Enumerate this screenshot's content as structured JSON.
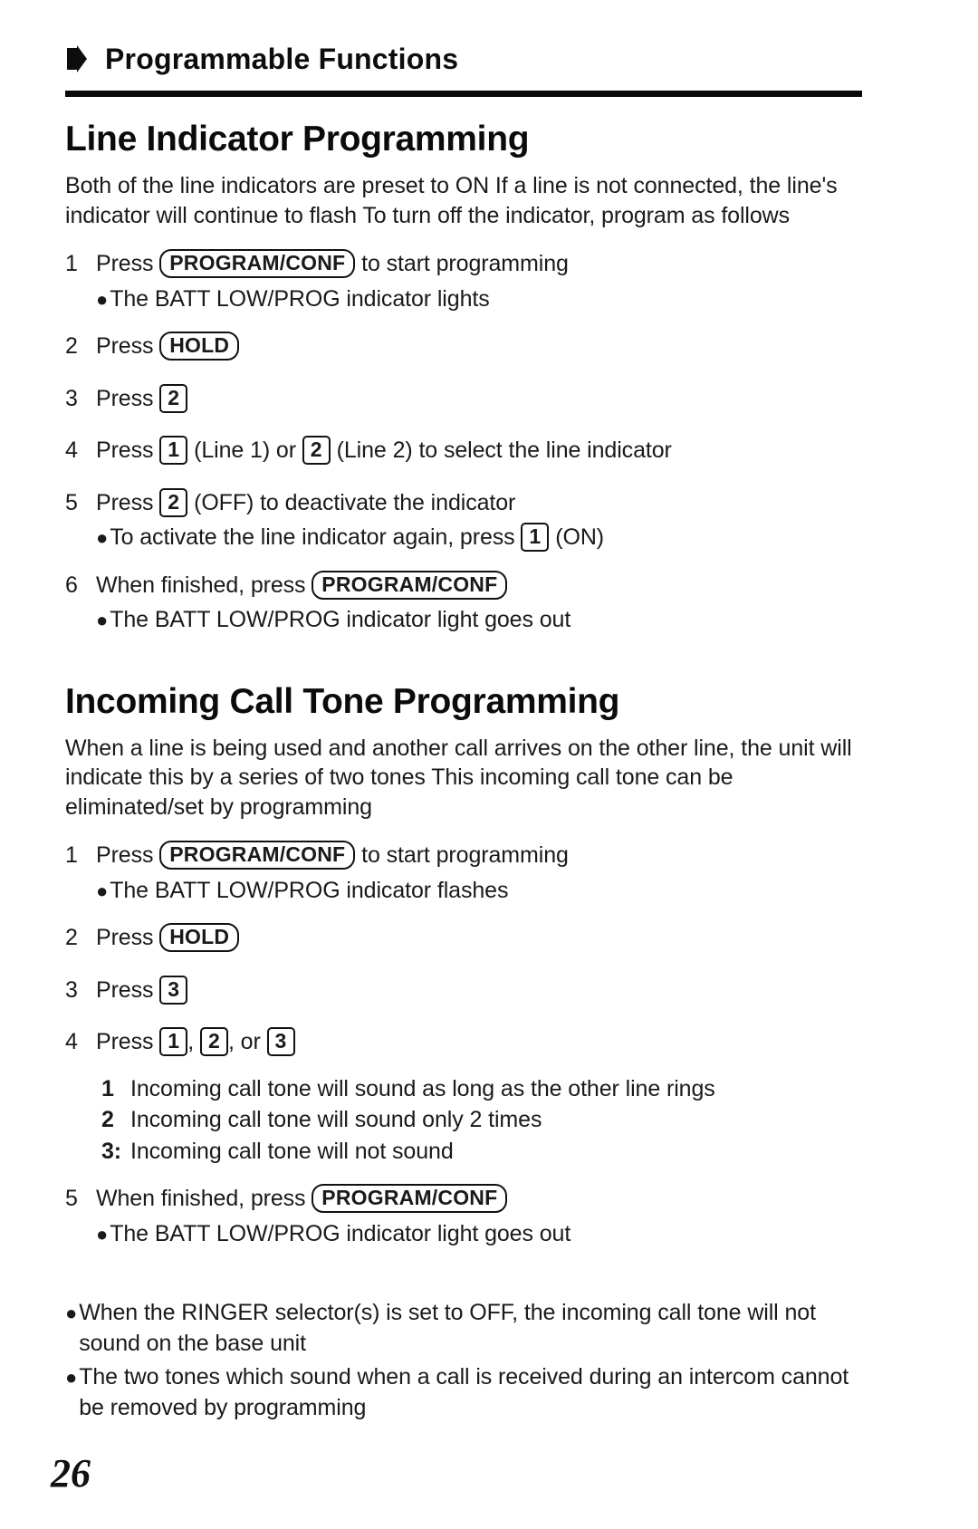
{
  "running_header": {
    "arrow_icon": "right-arrow-icon",
    "title": "Programmable Functions"
  },
  "sections": [
    {
      "title": "Line Indicator Programming",
      "intro": "Both of the line indicators are preset to ON  If a line is not connected, the line's indicator will continue to flash  To turn off the indicator, program as follows",
      "steps": [
        {
          "num": "1",
          "parts": [
            {
              "t": "text",
              "v": "Press "
            },
            {
              "t": "key",
              "v": "PROGRAM/CONF"
            },
            {
              "t": "text",
              "v": " to start programming"
            }
          ],
          "bullets": [
            "The BATT LOW/PROG indicator lights"
          ]
        },
        {
          "num": "2",
          "parts": [
            {
              "t": "text",
              "v": "Press "
            },
            {
              "t": "key",
              "v": "HOLD"
            }
          ],
          "bullets": []
        },
        {
          "num": "3",
          "parts": [
            {
              "t": "text",
              "v": "Press "
            },
            {
              "t": "numkey",
              "v": "2"
            }
          ],
          "bullets": []
        },
        {
          "num": "4",
          "parts": [
            {
              "t": "text",
              "v": "Press "
            },
            {
              "t": "numkey",
              "v": "1"
            },
            {
              "t": "text",
              "v": " (Line 1) or "
            },
            {
              "t": "numkey",
              "v": "2"
            },
            {
              "t": "text",
              "v": " (Line 2) to select the line indicator"
            }
          ],
          "bullets": []
        },
        {
          "num": "5",
          "parts": [
            {
              "t": "text",
              "v": "Press "
            },
            {
              "t": "numkey",
              "v": "2"
            },
            {
              "t": "text",
              "v": " (OFF) to deactivate the indicator"
            }
          ],
          "bullets_rich": [
            [
              {
                "t": "text",
                "v": "To activate the line indicator again, press "
              },
              {
                "t": "numkey",
                "v": "1"
              },
              {
                "t": "text",
                "v": " (ON)"
              }
            ]
          ]
        },
        {
          "num": "6",
          "parts": [
            {
              "t": "text",
              "v": "When finished, press "
            },
            {
              "t": "key",
              "v": "PROGRAM/CONF"
            }
          ],
          "bullets": [
            "The BATT LOW/PROG indicator light goes out"
          ]
        }
      ]
    },
    {
      "title": "Incoming Call Tone Programming",
      "intro": "When a line is being used and another call arrives on the other line, the unit will indicate this by a series of two tones  This incoming call tone can be eliminated/set by programming",
      "steps": [
        {
          "num": "1",
          "parts": [
            {
              "t": "text",
              "v": "Press "
            },
            {
              "t": "key",
              "v": "PROGRAM/CONF"
            },
            {
              "t": "text",
              "v": " to start programming"
            }
          ],
          "bullets": [
            "The BATT LOW/PROG indicator flashes"
          ]
        },
        {
          "num": "2",
          "parts": [
            {
              "t": "text",
              "v": "Press "
            },
            {
              "t": "key",
              "v": "HOLD"
            }
          ],
          "bullets": []
        },
        {
          "num": "3",
          "parts": [
            {
              "t": "text",
              "v": "Press "
            },
            {
              "t": "numkey",
              "v": "3"
            }
          ],
          "bullets": []
        },
        {
          "num": "4",
          "parts": [
            {
              "t": "text",
              "v": "Press "
            },
            {
              "t": "numkey",
              "v": "1"
            },
            {
              "t": "text",
              "v": ", "
            },
            {
              "t": "numkey",
              "v": "2"
            },
            {
              "t": "text",
              "v": ", or "
            },
            {
              "t": "numkey",
              "v": "3"
            }
          ],
          "bullets": [],
          "inner_list": [
            {
              "num": "1",
              "text": "Incoming call tone will sound as long as the other line rings"
            },
            {
              "num": "2",
              "text": "Incoming call tone will sound only 2 times"
            },
            {
              "num": "3:",
              "text": "Incoming call tone will not sound"
            }
          ]
        },
        {
          "num": "5",
          "parts": [
            {
              "t": "text",
              "v": "When finished, press "
            },
            {
              "t": "key",
              "v": "PROGRAM/CONF"
            }
          ],
          "bullets": [
            "The BATT LOW/PROG indicator light goes out"
          ]
        }
      ],
      "notes": [
        "When the RINGER selector(s) is set to OFF, the incoming call tone will not sound on the base unit",
        "The two tones which sound when a call is received during an intercom cannot be removed by programming"
      ]
    }
  ],
  "page_number": "26",
  "colors": {
    "ink": "#111111",
    "paper": "#ffffff"
  }
}
